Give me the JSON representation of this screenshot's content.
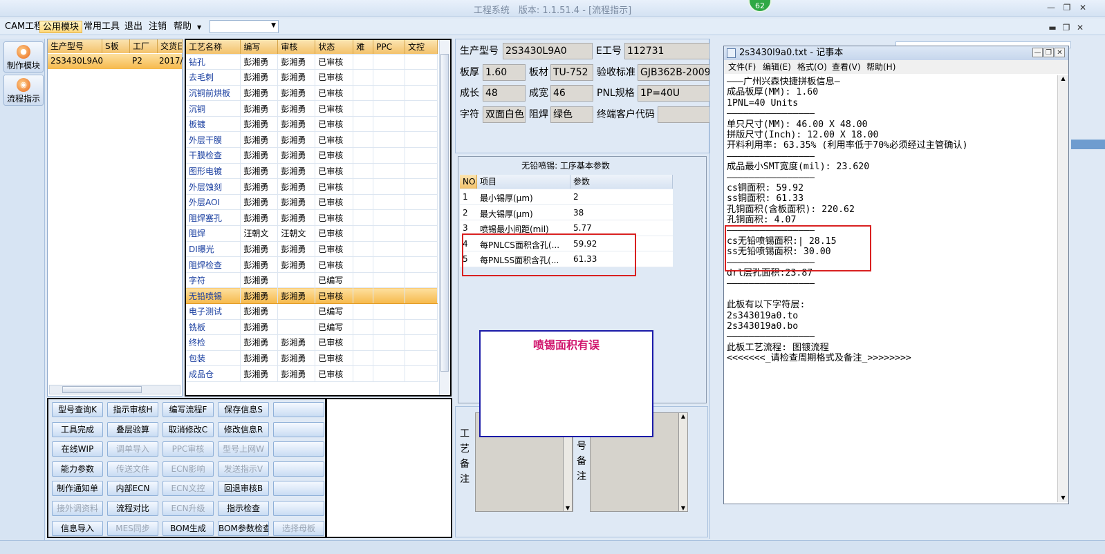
{
  "window": {
    "title": "工程系统　版本: 1.1.51.4 - [流程指示]",
    "badge": "62",
    "minimize": "—",
    "restore": "❐",
    "close": "✕"
  },
  "menubar": {
    "items": [
      "CAM工程",
      "公用模块",
      "常用工具",
      "退出",
      "注销",
      "帮助"
    ],
    "active": "公用模块",
    "dropdown_arrow": "▼",
    "combo_value": "",
    "mdi_min": "▬",
    "mdi_restore": "❐",
    "mdi_close": "✕"
  },
  "leftnav": {
    "items": [
      {
        "label": "制作模块",
        "icon": "gear-icon"
      },
      {
        "label": "流程指示",
        "icon": "flow-icon"
      }
    ]
  },
  "orders": {
    "columns": [
      "生产型号",
      "S板",
      "工厂",
      "交货日"
    ],
    "rows": [
      [
        "2S3430L9A0",
        "",
        "P2",
        "2017/"
      ]
    ]
  },
  "process": {
    "columns": [
      "工艺名称",
      "编写",
      "审核",
      "状态",
      "难",
      "PPC",
      "文控"
    ],
    "rows": [
      [
        "钻孔",
        "彭湘勇",
        "彭湘勇",
        "已审核"
      ],
      [
        "去毛刺",
        "彭湘勇",
        "彭湘勇",
        "已审核"
      ],
      [
        "沉铜前烘板",
        "彭湘勇",
        "彭湘勇",
        "已审核"
      ],
      [
        "沉铜",
        "彭湘勇",
        "彭湘勇",
        "已审核"
      ],
      [
        "板镀",
        "彭湘勇",
        "彭湘勇",
        "已审核"
      ],
      [
        "外层干膜",
        "彭湘勇",
        "彭湘勇",
        "已审核"
      ],
      [
        "干膜检查",
        "彭湘勇",
        "彭湘勇",
        "已审核"
      ],
      [
        "图形电镀",
        "彭湘勇",
        "彭湘勇",
        "已审核"
      ],
      [
        "外层蚀刻",
        "彭湘勇",
        "彭湘勇",
        "已审核"
      ],
      [
        "外层AOI",
        "彭湘勇",
        "彭湘勇",
        "已审核"
      ],
      [
        "阻焊塞孔",
        "彭湘勇",
        "彭湘勇",
        "已审核"
      ],
      [
        "阻焊",
        "汪朝文",
        "汪朝文",
        "已审核"
      ],
      [
        "DI曝光",
        "彭湘勇",
        "彭湘勇",
        "已审核"
      ],
      [
        "阻焊检查",
        "彭湘勇",
        "彭湘勇",
        "已审核"
      ],
      [
        "字符",
        "彭湘勇",
        "",
        "已编写"
      ],
      [
        "无铅喷锡",
        "彭湘勇",
        "彭湘勇",
        "已审核"
      ],
      [
        "电子测试",
        "彭湘勇",
        "",
        "已编写"
      ],
      [
        "铣板",
        "彭湘勇",
        "",
        "已编写"
      ],
      [
        "终检",
        "彭湘勇",
        "彭湘勇",
        "已审核"
      ],
      [
        "包装",
        "彭湘勇",
        "彭湘勇",
        "已审核"
      ],
      [
        "成品仓",
        "彭湘勇",
        "彭湘勇",
        "已审核"
      ]
    ],
    "selected_index": 15
  },
  "buttons": [
    [
      "型号查询K",
      "指示审核H",
      "编写流程F",
      "保存信息S",
      ""
    ],
    [
      "工具完成",
      "叠层验算",
      "取消修改C",
      "修改信息R",
      ""
    ],
    [
      "在线WIP",
      "调单导入",
      "PPC审核",
      "型号上网W",
      ""
    ],
    [
      "能力参数",
      "传送文件",
      "ECN影响",
      "发送指示V",
      ""
    ],
    [
      "制作通知单",
      "内部ECN",
      "ECN文控",
      "回退审核B",
      ""
    ],
    [
      "接外调资料",
      "流程对比",
      "ECN升级",
      "指示检查",
      ""
    ],
    [
      "信息导入",
      "MES同步",
      "BOM生成",
      "BOM参数检查",
      "选择母板"
    ]
  ],
  "buttons_disabled": [
    [
      false,
      false,
      false,
      false,
      false
    ],
    [
      false,
      false,
      false,
      false,
      false
    ],
    [
      false,
      true,
      true,
      true,
      false
    ],
    [
      false,
      true,
      true,
      true,
      false
    ],
    [
      false,
      false,
      true,
      false,
      false
    ],
    [
      true,
      false,
      true,
      false,
      false
    ],
    [
      false,
      true,
      false,
      false,
      true
    ]
  ],
  "info": {
    "row1": [
      {
        "label": "生产型号",
        "value": "2S3430L9A0"
      },
      {
        "label": "E工号",
        "value": "112731"
      }
    ],
    "row2": [
      {
        "label": "板厚",
        "value": "1.60"
      },
      {
        "label": "板材",
        "value": "TU-752"
      },
      {
        "label": "验收标准",
        "value": "GJB362B-2009"
      }
    ],
    "row3": [
      {
        "label": "成长",
        "value": "48"
      },
      {
        "label": "成宽",
        "value": "46"
      },
      {
        "label": "PNL规格",
        "value": "1P=40U"
      }
    ],
    "row4": [
      {
        "label": "字符",
        "value": "双面白色"
      },
      {
        "label": "阻焊",
        "value": "绿色"
      },
      {
        "label": "终端客户代码",
        "value": ""
      }
    ]
  },
  "param": {
    "title": "无铅喷锡: 工序基本参数",
    "columns": [
      "NO",
      "项目",
      "参数"
    ],
    "rows": [
      [
        "1",
        "最小锡厚(μm)",
        "2"
      ],
      [
        "2",
        "最大锡厚(μm)",
        "38"
      ],
      [
        "3",
        "喷锡最小间距(mil)",
        "5.77"
      ],
      [
        "4",
        "每PNLCS面积含孔(...",
        "59.92"
      ],
      [
        "5",
        "每PNLSS面积含孔(...",
        "61.33"
      ]
    ]
  },
  "remarks": {
    "left_label": "工艺备注",
    "right_label": "号备注",
    "arrow_up": "▲",
    "arrow_down": "▼"
  },
  "message": "喷锡面积有误",
  "notepad": {
    "title": "2s3430l9a0.txt - 记事本",
    "menu": [
      "文件(F)",
      "编辑(E)",
      "格式(O)",
      "查看(V)",
      "帮助(H)"
    ],
    "lines": [
      "———广州兴森快捷拼板信息—",
      "成品板厚(MM): 1.60",
      "1PNL=40 Units",
      "————————————————",
      "单只尺寸(MM): 46.00 X 48.00",
      "拼版尺寸(Inch): 12.00 X 18.00",
      "开料利用率: 63.35% (利用率低于70%必须经过主管确认)",
      "————————————————",
      "成品最小SMT宽度(mil): 23.620",
      "————————————————",
      "cs铜面积: 59.92",
      "ss铜面积: 61.33",
      "孔铜面积(含板面积): 220.62",
      "孔铜面积: 4.07",
      "————————————————",
      "cs无铅喷锡面积:| 28.15",
      "ss无铅喷锡面积: 30.00",
      "————————————————",
      "drl层孔面积:23.87",
      "————————————————",
      "",
      "此板有以下字符层:",
      "2s343019a0.to",
      "2s343019a0.bo",
      "————————————————",
      "此板工艺流程: 图镀流程",
      "<<<<<<<_请检查周期格式及备注_>>>>>>>>"
    ]
  }
}
